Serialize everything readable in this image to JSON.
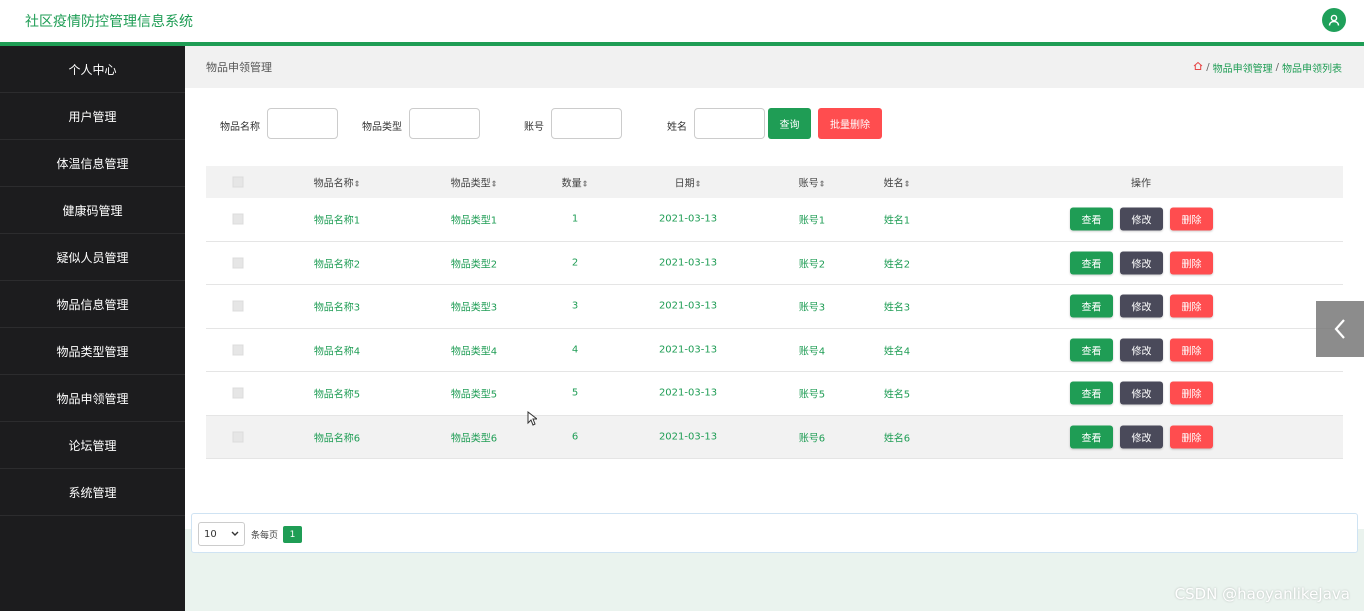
{
  "app": {
    "title": "社区疫情防控管理信息系统"
  },
  "sidebar": {
    "items": [
      {
        "label": "个人中心"
      },
      {
        "label": "用户管理"
      },
      {
        "label": "体温信息管理"
      },
      {
        "label": "健康码管理"
      },
      {
        "label": "疑似人员管理"
      },
      {
        "label": "物品信息管理"
      },
      {
        "label": "物品类型管理"
      },
      {
        "label": "物品申领管理"
      },
      {
        "label": "论坛管理"
      },
      {
        "label": "系统管理"
      }
    ]
  },
  "page": {
    "title": "物品申领管理",
    "breadcrumb": [
      "物品申领管理",
      "物品申领列表"
    ],
    "breadcrumb_sep": "/"
  },
  "search": {
    "fields": [
      {
        "label": "物品名称",
        "value": ""
      },
      {
        "label": "物品类型",
        "value": ""
      },
      {
        "label": "账号",
        "value": ""
      },
      {
        "label": "姓名",
        "value": ""
      }
    ],
    "query_label": "查询",
    "batch_delete_label": "批量删除"
  },
  "table": {
    "columns": [
      "物品名称",
      "物品类型",
      "数量",
      "日期",
      "账号",
      "姓名",
      "操作"
    ],
    "sort_icon": "⇕",
    "rows": [
      {
        "name": "物品名称1",
        "type": "物品类型1",
        "qty": "1",
        "date": "2021-03-13",
        "account": "账号1",
        "person": "姓名1"
      },
      {
        "name": "物品名称2",
        "type": "物品类型2",
        "qty": "2",
        "date": "2021-03-13",
        "account": "账号2",
        "person": "姓名2"
      },
      {
        "name": "物品名称3",
        "type": "物品类型3",
        "qty": "3",
        "date": "2021-03-13",
        "account": "账号3",
        "person": "姓名3"
      },
      {
        "name": "物品名称4",
        "type": "物品类型4",
        "qty": "4",
        "date": "2021-03-13",
        "account": "账号4",
        "person": "姓名4"
      },
      {
        "name": "物品名称5",
        "type": "物品类型5",
        "qty": "5",
        "date": "2021-03-13",
        "account": "账号5",
        "person": "姓名5"
      },
      {
        "name": "物品名称6",
        "type": "物品类型6",
        "qty": "6",
        "date": "2021-03-13",
        "account": "账号6",
        "person": "姓名6"
      }
    ],
    "actions": {
      "view": "查看",
      "edit": "修改",
      "delete": "删除"
    }
  },
  "pagination": {
    "page_size": "10",
    "per_page_label": "条每页",
    "current_page": "1"
  },
  "watermark": "CSDN @haoyanlikeJava",
  "colors": {
    "accent": "#1f9d55",
    "danger": "#ff4d4f",
    "sidebar": "#1c1c1e",
    "edit": "#4a4a5a"
  }
}
